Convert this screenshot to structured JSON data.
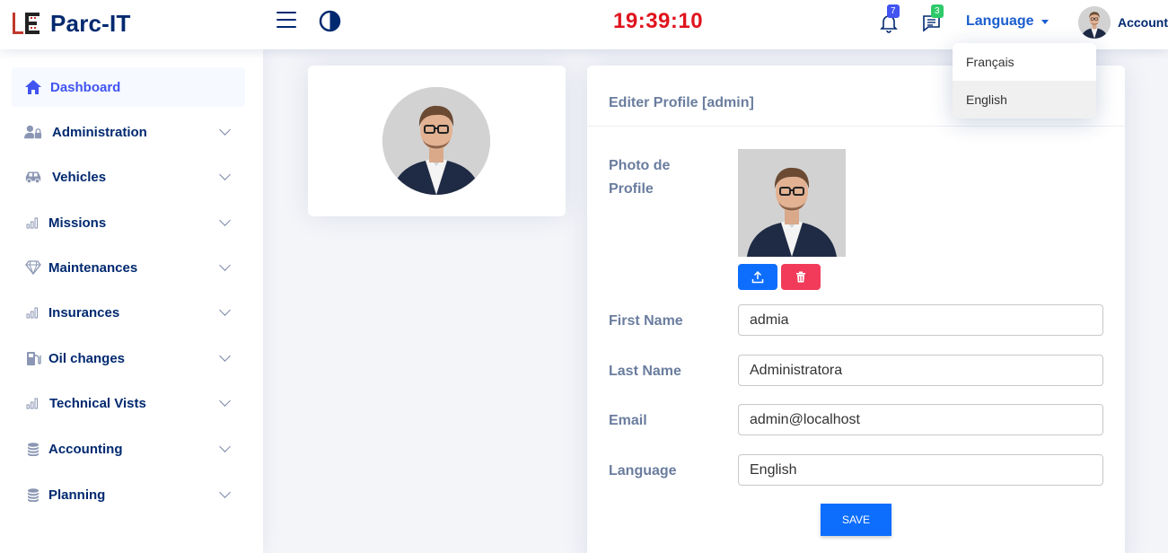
{
  "header": {
    "app_name": "Parc-IT",
    "clock": "19:39:10",
    "notifications_count": "7",
    "messages_count": "3",
    "language_label": "Language",
    "account_label": "Account"
  },
  "language_menu": {
    "items": [
      {
        "label": "Français"
      },
      {
        "label": "English"
      }
    ],
    "selected": "English"
  },
  "sidebar": {
    "items": [
      {
        "label": "Dashboard",
        "icon": "home-icon",
        "active": true
      },
      {
        "label": "Administration",
        "icon": "user-lock-icon"
      },
      {
        "label": "Vehicles",
        "icon": "car-icon"
      },
      {
        "label": "Missions",
        "icon": "bar-chart-icon"
      },
      {
        "label": "Maintenances",
        "icon": "gem-icon"
      },
      {
        "label": "Insurances",
        "icon": "bar-chart-icon"
      },
      {
        "label": "Oil changes",
        "icon": "gas-pump-icon"
      },
      {
        "label": "Technical Vists",
        "icon": "bar-chart-icon"
      },
      {
        "label": "Accounting",
        "icon": "coins-icon"
      },
      {
        "label": "Planning",
        "icon": "coins-icon"
      }
    ]
  },
  "profile_form": {
    "title": "Editer Profile",
    "username": "[admin]",
    "photo_label_line1": "Photo de",
    "photo_label_line2": "Profile",
    "first_name_label": "First Name",
    "first_name_value": "admia",
    "last_name_label": "Last Name",
    "last_name_value": "Administratora",
    "email_label": "Email",
    "email_value": "admin@localhost",
    "language_label": "Language",
    "language_value": "English",
    "save_label": "SAVE"
  },
  "colors": {
    "primary": "#4154f1",
    "navy": "#012970",
    "clock": "#e0141e",
    "button_blue": "#0d6efd",
    "button_red": "#f23b5a",
    "badge_green": "#2eca6a"
  }
}
